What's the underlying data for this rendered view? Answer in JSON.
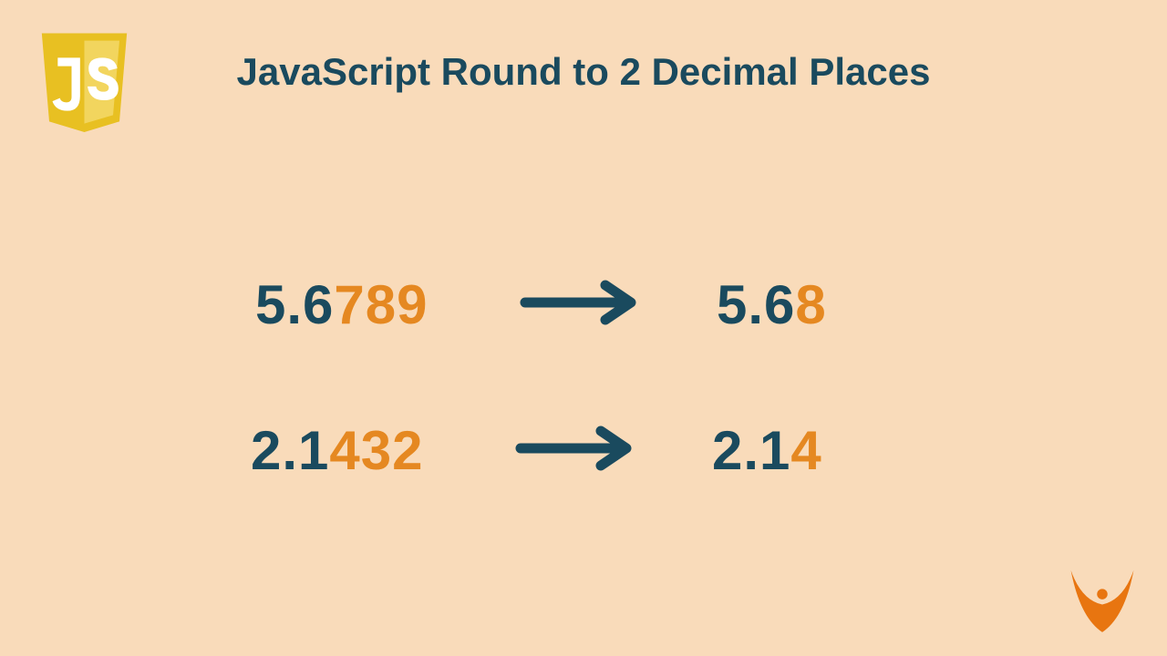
{
  "title": "JavaScript Round to 2 Decimal Places",
  "examples": [
    {
      "input": {
        "prefix": "5.6",
        "highlighted": "789"
      },
      "output": {
        "prefix": "5.6",
        "highlighted": "8"
      }
    },
    {
      "input": {
        "prefix": "2.1",
        "highlighted": "432"
      },
      "output": {
        "prefix": "2.1",
        "highlighted": "4"
      }
    }
  ],
  "colors": {
    "background": "#f9dbba",
    "text_dark": "#1a4a5e",
    "text_orange": "#e58821",
    "logo_yellow": "#e8c022",
    "logo_yellow_light": "#f2d55e",
    "person_orange": "#e87510"
  },
  "icons": {
    "js_logo": "js-shield-icon",
    "arrow": "arrow-right-icon",
    "brand": "person-raised-arms-icon"
  }
}
